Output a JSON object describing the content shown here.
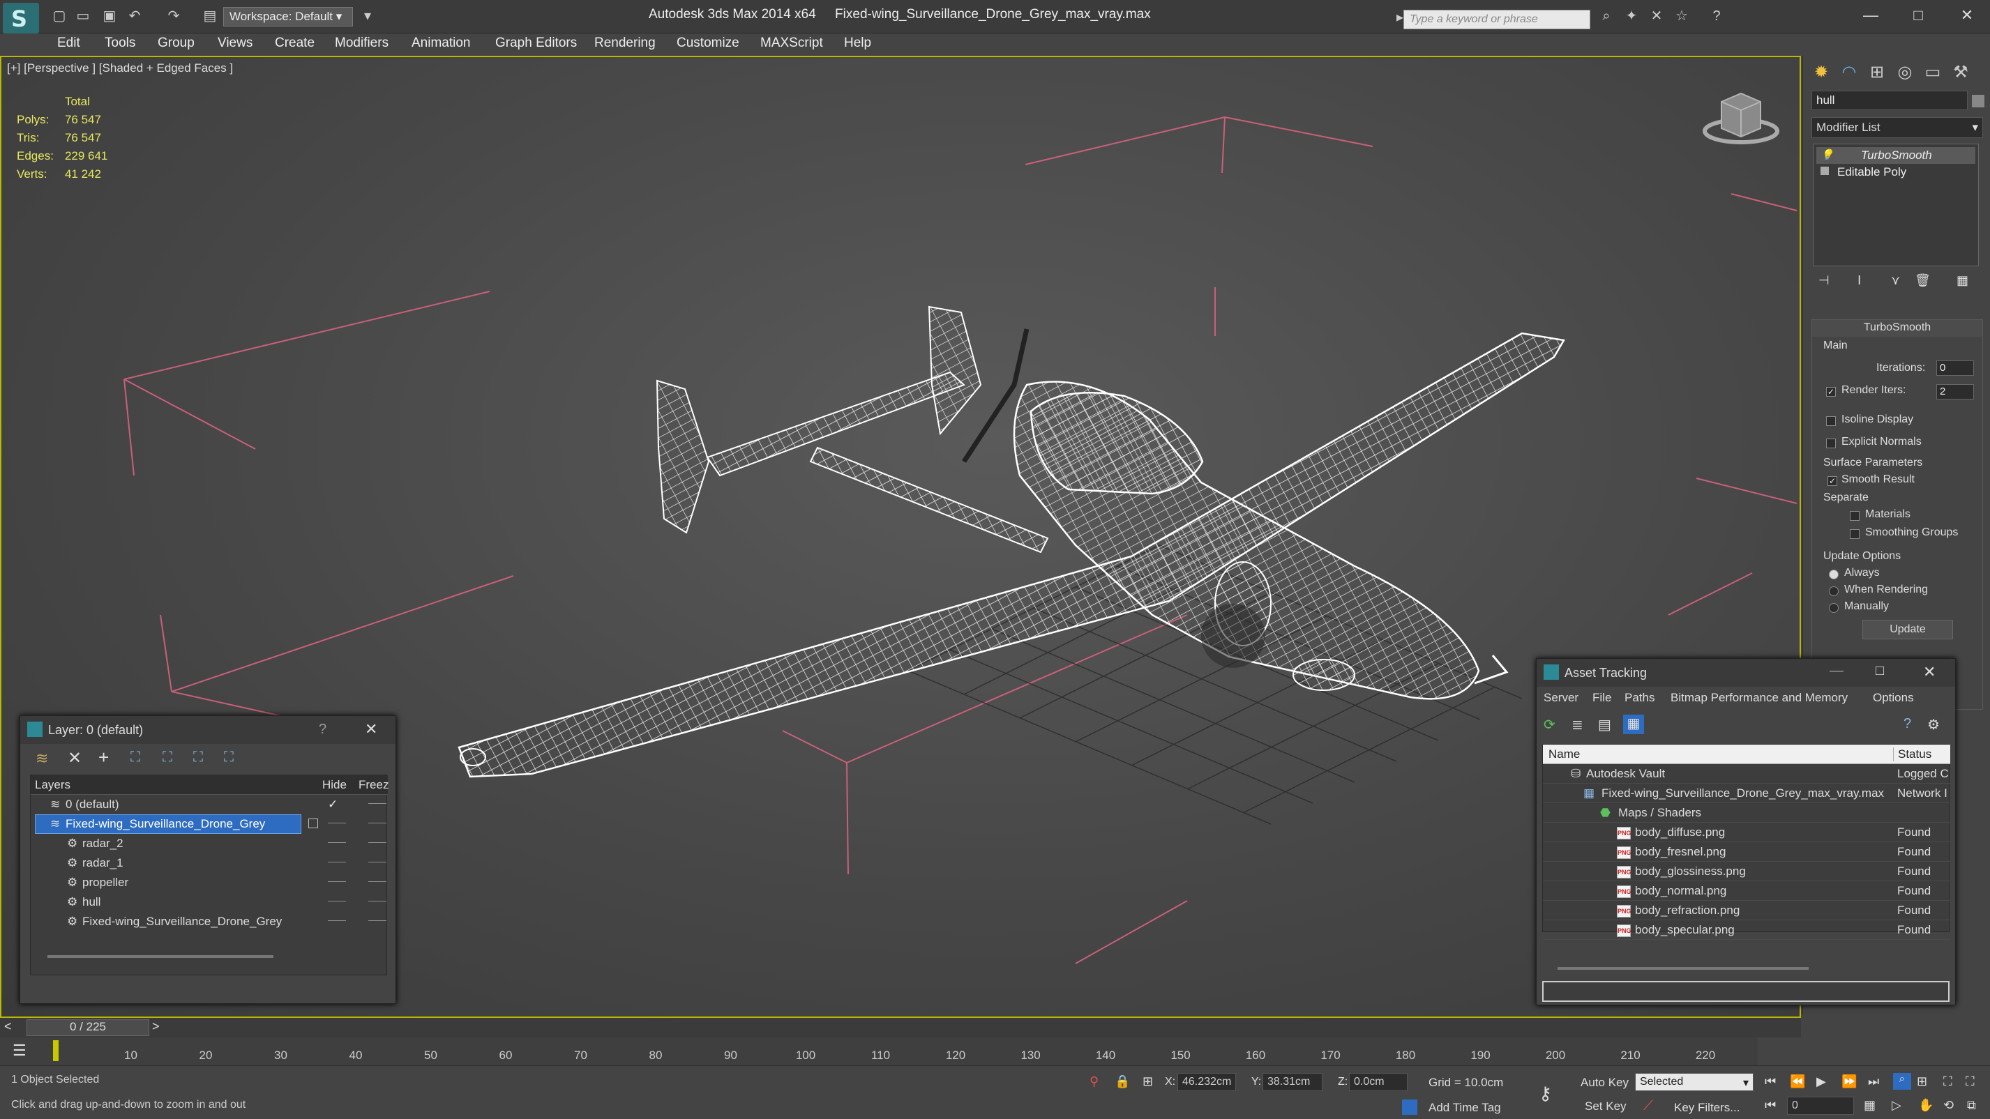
{
  "app": {
    "title": "Autodesk 3ds Max  2014 x64",
    "file_name": "Fixed-wing_Surveillance_Drone_Grey_max_vray.max",
    "workspace_label": "Workspace: Default",
    "search_placeholder": "Type a keyword or phrase"
  },
  "menu": [
    "Edit",
    "Tools",
    "Group",
    "Views",
    "Create",
    "Modifiers",
    "Animation",
    "Graph Editors",
    "Rendering",
    "Customize",
    "MAXScript",
    "Help"
  ],
  "viewport": {
    "label": "[+] [Perspective ] [Shaded + Edged Faces ]",
    "stats": {
      "header": "Total",
      "rows": [
        {
          "label": "Polys:",
          "value": "76 547"
        },
        {
          "label": "Tris:",
          "value": "76 547"
        },
        {
          "label": "Edges:",
          "value": "229 641"
        },
        {
          "label": "Verts:",
          "value": "41 242"
        }
      ]
    }
  },
  "command_panel": {
    "object_name": "hull",
    "modifier_list_label": "Modifier List",
    "stack": [
      "TurboSmooth",
      "Editable Poly"
    ],
    "rollout_title": "TurboSmooth",
    "main_label": "Main",
    "iterations_label": "Iterations:",
    "iterations_value": "0",
    "render_iters_label": "Render Iters:",
    "render_iters_value": "2",
    "isoline_label": "Isoline Display",
    "explicit_normals_label": "Explicit Normals",
    "surface_params_label": "Surface Parameters",
    "smooth_result_label": "Smooth Result",
    "separate_label": "Separate",
    "materials_label": "Materials",
    "smoothing_groups_label": "Smoothing Groups",
    "update_options_label": "Update Options",
    "always_label": "Always",
    "when_rendering_label": "When Rendering",
    "manually_label": "Manually",
    "update_button": "Update"
  },
  "layer_dialog": {
    "title": "Layer: 0 (default)",
    "help": "?",
    "col_layers": "Layers",
    "col_hide": "Hide",
    "col_freeze": "Freez",
    "rows": [
      {
        "name": "0 (default)",
        "indent": 0,
        "selected": false,
        "hide": "✓",
        "freeze": "——"
      },
      {
        "name": "Fixed-wing_Surveillance_Drone_Grey",
        "indent": 0,
        "selected": true,
        "hide": "——",
        "freeze": "——"
      },
      {
        "name": "radar_2",
        "indent": 1,
        "selected": false,
        "hide": "——",
        "freeze": "——"
      },
      {
        "name": "radar_1",
        "indent": 1,
        "selected": false,
        "hide": "——",
        "freeze": "——"
      },
      {
        "name": "propeller",
        "indent": 1,
        "selected": false,
        "hide": "——",
        "freeze": "——"
      },
      {
        "name": "hull",
        "indent": 1,
        "selected": false,
        "hide": "——",
        "freeze": "——"
      },
      {
        "name": "Fixed-wing_Surveillance_Drone_Grey",
        "indent": 1,
        "selected": false,
        "hide": "——",
        "freeze": "——"
      }
    ]
  },
  "asset_dialog": {
    "title": "Asset Tracking",
    "menu": [
      "Server",
      "File",
      "Paths",
      "Bitmap Performance and Memory",
      "Options"
    ],
    "col_name": "Name",
    "col_status": "Status",
    "rows": [
      {
        "name": "Autodesk Vault",
        "level": 0,
        "icon": "vault-icon",
        "status": "Logged C"
      },
      {
        "name": "Fixed-wing_Surveillance_Drone_Grey_max_vray.max",
        "level": 1,
        "icon": "max-file-icon",
        "status": "Network I"
      },
      {
        "name": "Maps / Shaders",
        "level": 2,
        "icon": "maps-icon",
        "status": ""
      },
      {
        "name": "body_diffuse.png",
        "level": 3,
        "icon": "png-icon",
        "status": "Found"
      },
      {
        "name": "body_fresnel.png",
        "level": 3,
        "icon": "png-icon",
        "status": "Found"
      },
      {
        "name": "body_glossiness.png",
        "level": 3,
        "icon": "png-icon",
        "status": "Found"
      },
      {
        "name": "body_normal.png",
        "level": 3,
        "icon": "png-icon",
        "status": "Found"
      },
      {
        "name": "body_refraction.png",
        "level": 3,
        "icon": "png-icon",
        "status": "Found"
      },
      {
        "name": "body_specular.png",
        "level": 3,
        "icon": "png-icon",
        "status": "Found"
      }
    ]
  },
  "timeline": {
    "frame_readout": "0 / 225",
    "ticks": [
      "10",
      "20",
      "30",
      "40",
      "50",
      "60",
      "70",
      "80",
      "90",
      "100",
      "110",
      "120",
      "130",
      "140",
      "150",
      "160",
      "170",
      "180",
      "190",
      "200",
      "210",
      "220"
    ]
  },
  "status": {
    "selection": "1 Object Selected",
    "prompt": "Click and drag up-and-down to zoom in and out",
    "x_label": "X:",
    "x_value": "46.232cm",
    "y_label": "Y:",
    "y_value": "38.31cm",
    "z_label": "Z:",
    "z_value": "0.0cm",
    "grid": "Grid = 10.0cm",
    "add_time_tag": "Add Time Tag",
    "auto_key": "Auto Key",
    "set_key": "Set Key",
    "selected_dropdown": "Selected",
    "key_filters": "Key Filters...",
    "frame_field": "0"
  },
  "colors": {
    "viewport_border": "#b8b800",
    "stats_text": "#e8e860",
    "selection_blue": "#2d6cc0",
    "bounding_lines": "#c8607a",
    "wireframe": "#ffffff"
  }
}
